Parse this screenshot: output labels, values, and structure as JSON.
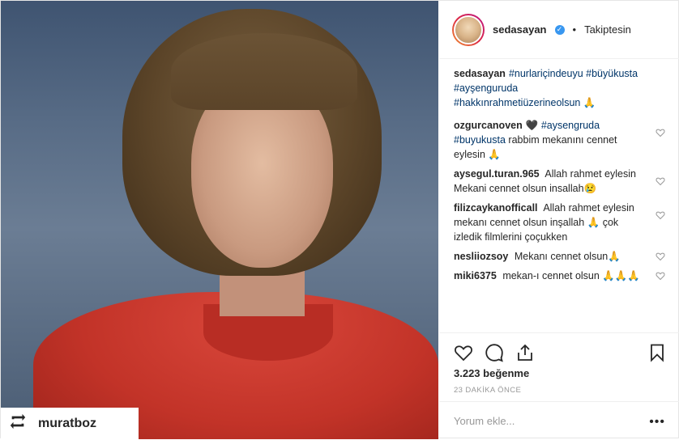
{
  "post": {
    "username": "sedasayan",
    "follow_status": "Takiptesin",
    "separator": "•",
    "repost_from": "muratboz"
  },
  "caption": {
    "user": "sedasayan",
    "hashtags": "#nurlariçindeuyu #büyükusta #ayşenguruda #hakkınrahmetiüzerineolsun",
    "emoji": "🙏"
  },
  "comments": [
    {
      "user": "ozgurcanoven",
      "pre": "🖤",
      "hashtags": "#aysengruda #buyukusta",
      "text": "rabbim mekanını cennet eylesin 🙏"
    },
    {
      "user": "aysegul.turan.965",
      "pre": "",
      "hashtags": "",
      "text": "Allah rahmet eylesin Mekani cennet olsun insallah😢"
    },
    {
      "user": "filizcaykanofficall",
      "pre": "",
      "hashtags": "",
      "text": "Allah rahmet eylesin mekanı cennet olsun inşallah 🙏 çok izledik filmlerini çoçukken"
    },
    {
      "user": "nesliiozsoy",
      "pre": "",
      "hashtags": "",
      "text": "Mekanı cennet olsun🙏"
    },
    {
      "user": "miki6375",
      "pre": "",
      "hashtags": "",
      "text": "mekan-ı cennet olsun 🙏🙏🙏"
    }
  ],
  "likes": "3.223 beğenme",
  "timestamp": "23 DAKİKA ÖNCE",
  "add_comment": {
    "placeholder": "Yorum ekle..."
  },
  "more": "•••",
  "colors": {
    "hashtag": "#003569",
    "verified": "#3897f0",
    "muted": "#999999"
  },
  "icons": [
    "repost-icon",
    "verified-icon",
    "heart-icon",
    "comment-icon",
    "share-icon",
    "bookmark-icon",
    "more-icon"
  ]
}
